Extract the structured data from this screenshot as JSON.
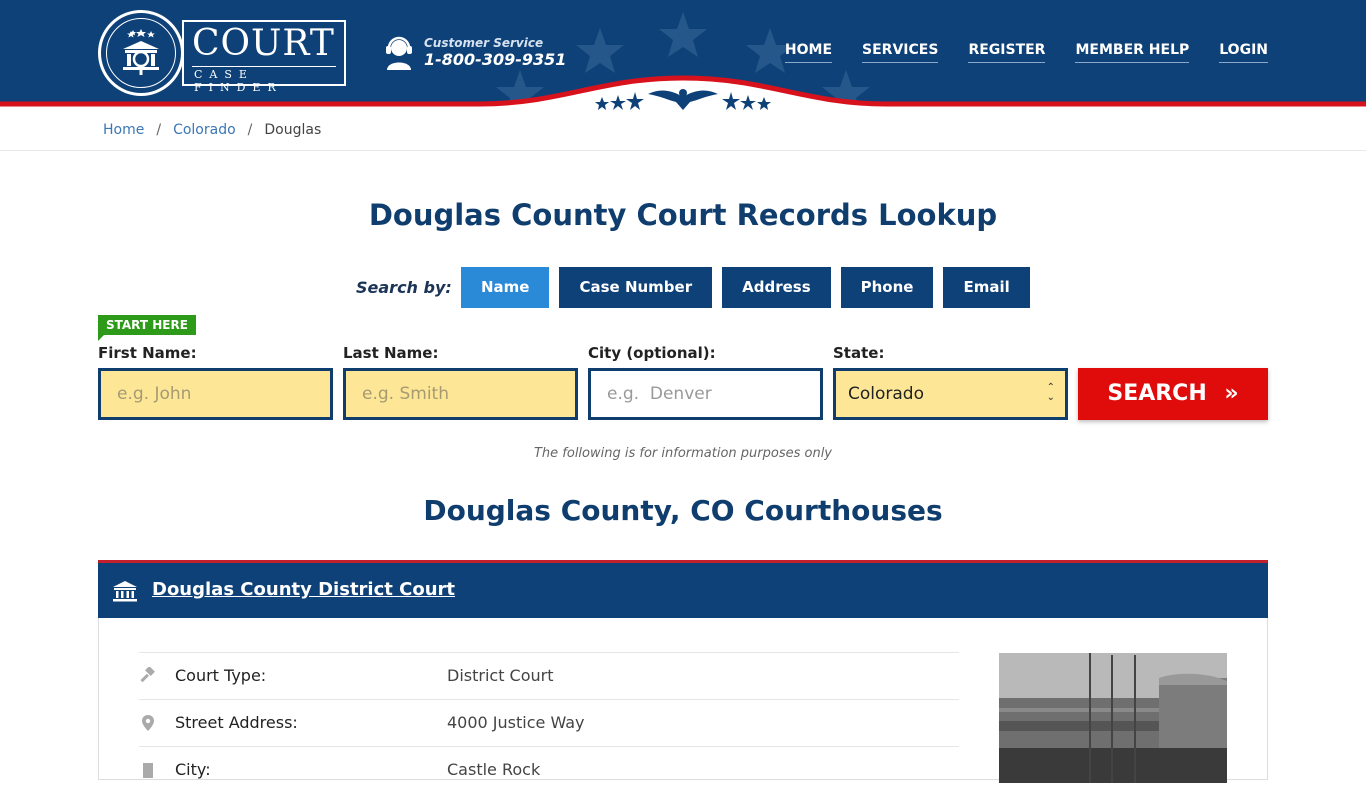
{
  "header": {
    "logo": {
      "title": "COURT",
      "subtitle": "CASE FINDER"
    },
    "customer_service": {
      "label": "Customer Service",
      "phone": "1-800-309-9351"
    },
    "nav": [
      "HOME",
      "SERVICES",
      "REGISTER",
      "MEMBER HELP",
      "LOGIN"
    ],
    "colors": {
      "primary": "#0e4178",
      "accent_red": "#e00b0b"
    }
  },
  "breadcrumb": {
    "items": [
      "Home",
      "Colorado",
      "Douglas"
    ],
    "separator": "/"
  },
  "page_title": "Douglas County Court Records Lookup",
  "search": {
    "search_by_label": "Search by:",
    "tabs": [
      {
        "label": "Name",
        "active": true
      },
      {
        "label": "Case Number",
        "active": false
      },
      {
        "label": "Address",
        "active": false
      },
      {
        "label": "Phone",
        "active": false
      },
      {
        "label": "Email",
        "active": false
      }
    ],
    "start_here": "START HERE",
    "fields": {
      "first_name": {
        "label": "First Name:",
        "placeholder": "e.g. John",
        "value": ""
      },
      "last_name": {
        "label": "Last Name:",
        "placeholder": "e.g. Smith",
        "value": ""
      },
      "city": {
        "label": "City (optional):",
        "placeholder": "e.g.  Denver",
        "value": ""
      },
      "state": {
        "label": "State:",
        "value": "Colorado"
      }
    },
    "button": "SEARCH",
    "button_icon": "»"
  },
  "info_note": "The following is for information purposes only",
  "courthouses": {
    "section_title": "Douglas County, CO Courthouses",
    "items": [
      {
        "name": "Douglas County District Court",
        "rows": [
          {
            "icon": "gavel-icon",
            "label": "Court Type:",
            "value": "District Court"
          },
          {
            "icon": "map-pin-icon",
            "label": "Street Address:",
            "value": "4000 Justice Way"
          },
          {
            "icon": "building-icon",
            "label": "City:",
            "value": "Castle Rock"
          }
        ]
      }
    ]
  }
}
